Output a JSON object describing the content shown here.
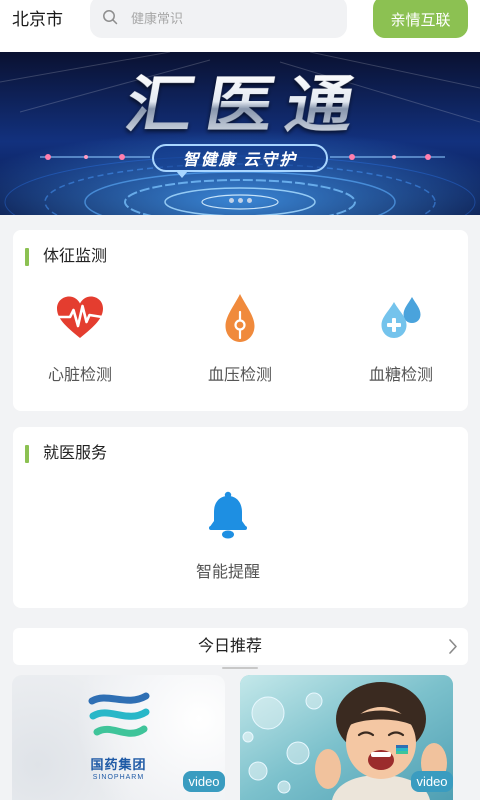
{
  "header": {
    "city": "北京市",
    "search_placeholder": "健康常识",
    "search_icon": "search-icon",
    "family_button": "亲情互联"
  },
  "banner": {
    "title": "汇医通",
    "slogan": "智健康 云守护",
    "slide_count": 3
  },
  "vitals": {
    "title": "体征监测",
    "items": [
      {
        "label": "心脏检测",
        "icon": "heart-pulse-icon"
      },
      {
        "label": "血压检测",
        "icon": "blood-drop-icon"
      },
      {
        "label": "血糖检测",
        "icon": "water-drops-plus-icon"
      }
    ]
  },
  "medical": {
    "title": "就医服务",
    "items": [
      {
        "label": "智能提醒",
        "icon": "bell-icon"
      }
    ]
  },
  "recommend": {
    "title": "今日推荐",
    "more_icon": "chevron-right-icon",
    "cards": [
      {
        "badge": "video",
        "logo_cn": "国药集团",
        "logo_en": "SINOPHARM"
      },
      {
        "badge": "video"
      }
    ]
  },
  "colors": {
    "accent": "#8cc152",
    "heart": "#e43d2f",
    "blood_drop": "#f08a3c",
    "glucose": "#5cb6e8",
    "bell": "#1e8fe2",
    "video_badge": "#3a9cc0",
    "page_background": "#f2f3f5"
  }
}
